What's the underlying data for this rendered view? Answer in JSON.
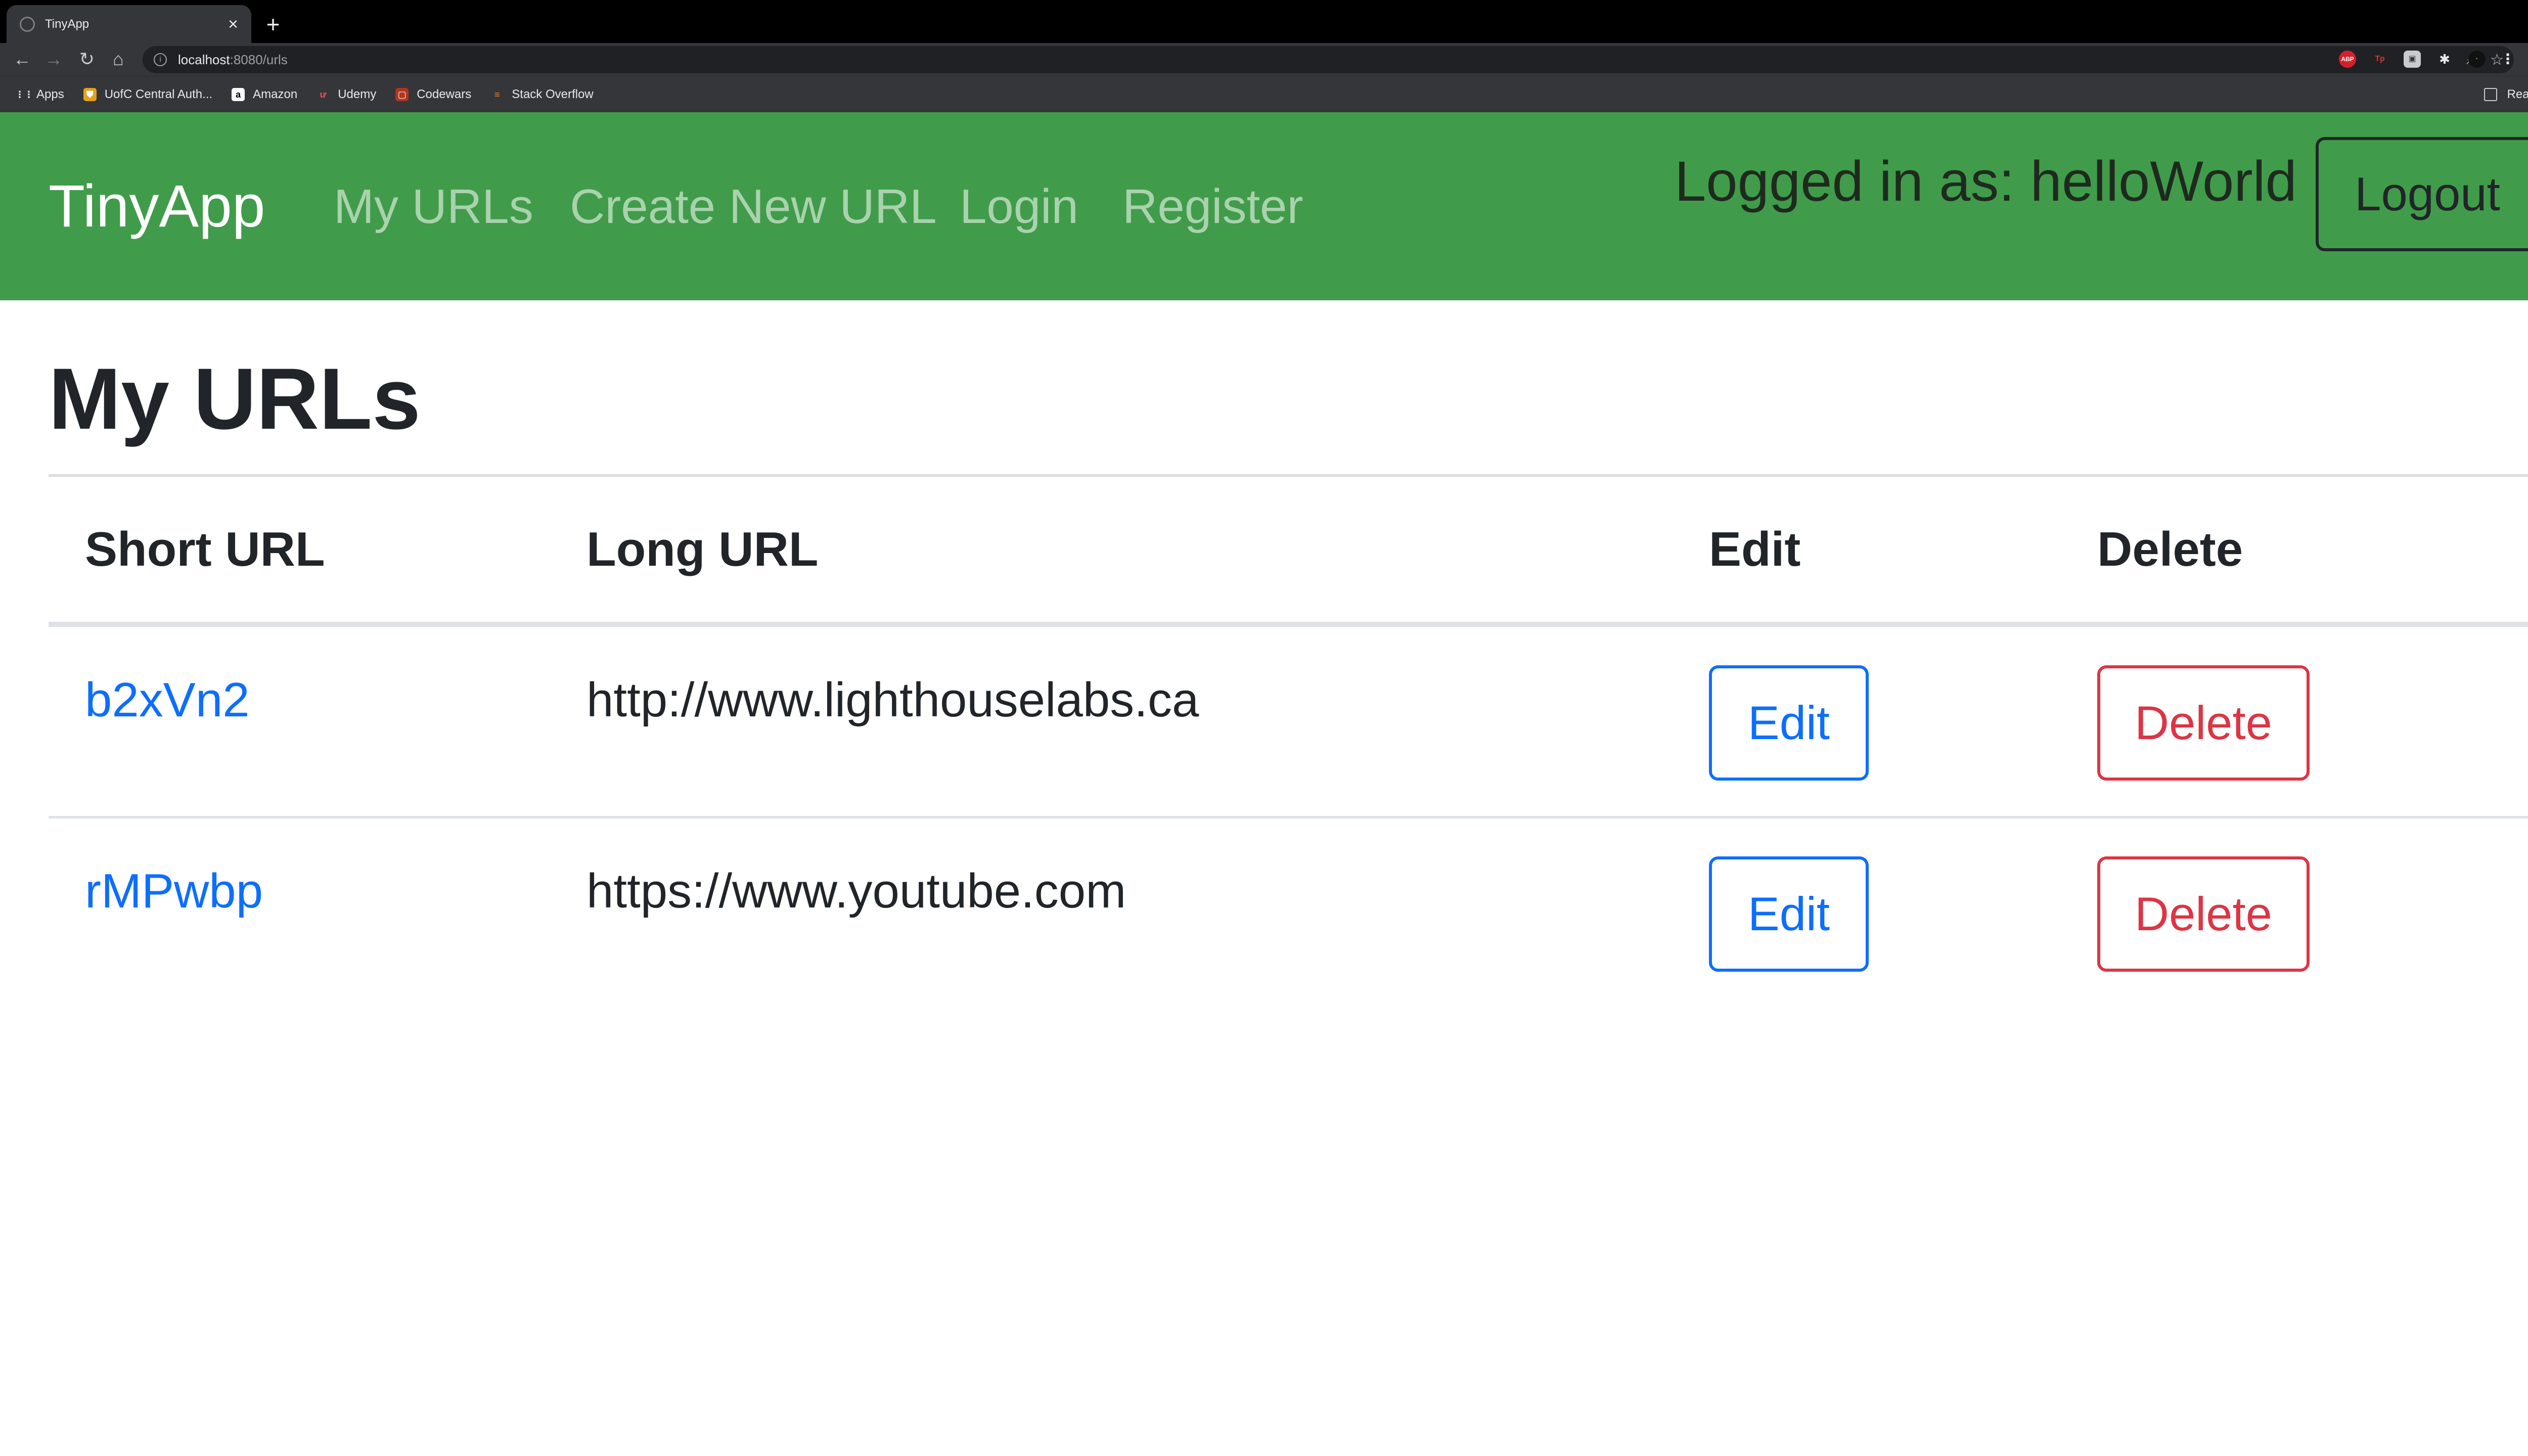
{
  "browser": {
    "tab_title": "TinyApp",
    "tab_close": "×",
    "new_tab": "+",
    "url_host": "localhost",
    "url_path": ":8080/urls",
    "bookmarks": [
      {
        "label": "Apps",
        "icon": "apps-grid-icon",
        "color": "#e8eaed"
      },
      {
        "label": "UofC Central Auth...",
        "icon": "uofc-shield-icon",
        "color": "#e3a21a"
      },
      {
        "label": "Amazon",
        "icon": "amazon-icon",
        "color": "#ffffff"
      },
      {
        "label": "Udemy",
        "icon": "udemy-icon",
        "color": "#ec5252"
      },
      {
        "label": "Codewars",
        "icon": "codewars-icon",
        "color": "#b1361e"
      },
      {
        "label": "Stack Overflow",
        "icon": "stackoverflow-icon",
        "color": "#f48024"
      }
    ],
    "reading_list": "Reading List"
  },
  "navbar": {
    "brand": "TinyApp",
    "links": [
      "My URLs",
      "Create New URL",
      "Login",
      "Register"
    ],
    "logged_in_text": "Logged in as: helloWorld",
    "logout_label": "Logout",
    "background": "#409c4a"
  },
  "main": {
    "title": "My URLs",
    "table": {
      "headers": [
        "Short URL",
        "Long URL",
        "Edit",
        "Delete"
      ],
      "rows": [
        {
          "short": "b2xVn2",
          "long": "http://www.lighthouselabs.ca",
          "edit": "Edit",
          "delete": "Delete"
        },
        {
          "short": "rMPwbp",
          "long": "https://www.youtube.com",
          "edit": "Edit",
          "delete": "Delete"
        }
      ]
    }
  },
  "colors": {
    "link": "#0d6efd",
    "danger": "#dc3545"
  }
}
